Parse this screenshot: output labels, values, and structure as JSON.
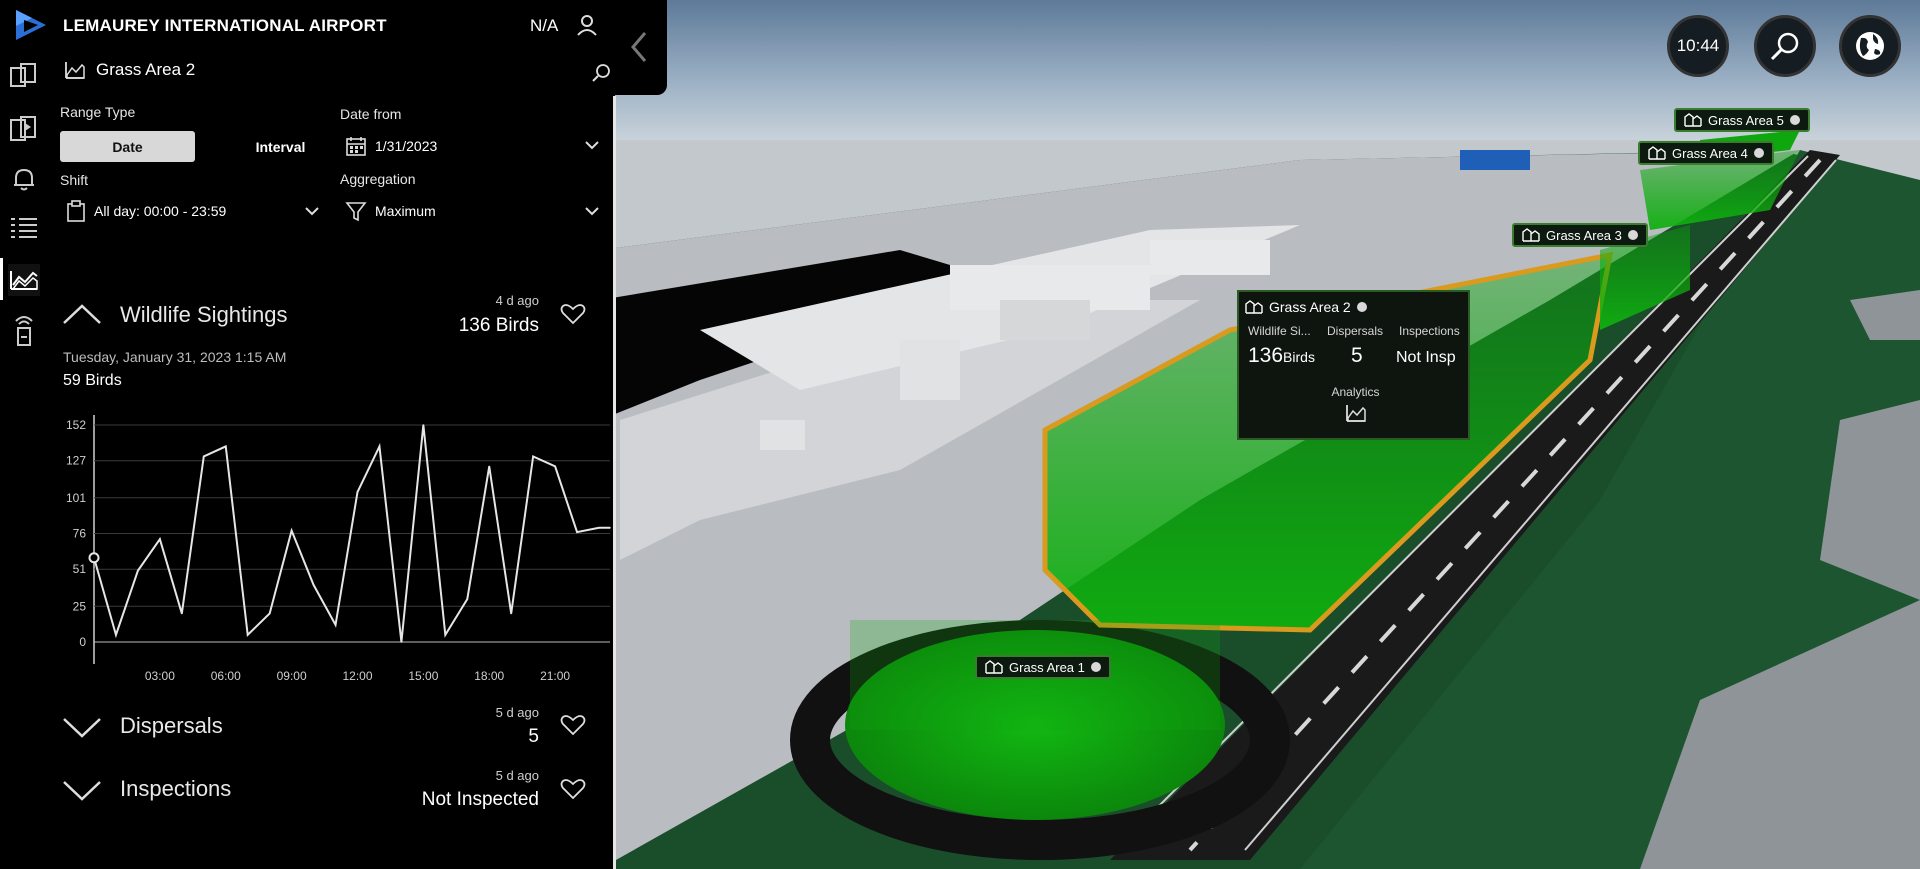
{
  "app": {
    "title": "LEMAUREY INTERNATIONAL AIRPORT",
    "status": "N/A"
  },
  "panel": {
    "area_name": "Grass Area 2",
    "range_type_label": "Range Type",
    "range_options": [
      "Date",
      "Interval"
    ],
    "range_selected": "Date",
    "date_from_label": "Date from",
    "date_from_value": "1/31/2023",
    "shift_label": "Shift",
    "shift_value": "All day: 00:00 - 23:59",
    "aggregation_label": "Aggregation",
    "aggregation_value": "Maximum"
  },
  "sections": {
    "wildlife": {
      "title": "Wildlife Sightings",
      "ago": "4 d ago",
      "value": "136 Birds",
      "selected_time": "Tuesday, January 31, 2023 1:15 AM",
      "selected_value": "59 Birds"
    },
    "dispersals": {
      "title": "Dispersals",
      "ago": "5 d ago",
      "value": "5"
    },
    "inspections": {
      "title": "Inspections",
      "ago": "5 d ago",
      "value": "Not Inspected"
    }
  },
  "chart_data": {
    "type": "line",
    "title": "",
    "xlabel": "",
    "ylabel": "",
    "x_ticks": [
      "03:00",
      "06:00",
      "09:00",
      "12:00",
      "15:00",
      "18:00",
      "21:00"
    ],
    "y_ticks": [
      "0",
      "25",
      "51",
      "76",
      "101",
      "127",
      "152"
    ],
    "ylim": [
      0,
      152
    ],
    "xlim": [
      0,
      23.5
    ],
    "x": [
      0,
      1,
      2,
      3,
      4,
      5,
      6,
      7,
      8,
      9,
      10,
      11,
      12,
      13,
      14,
      15,
      16,
      17,
      18,
      19,
      20,
      21,
      22,
      23,
      23.5
    ],
    "values": [
      59,
      5,
      50,
      72,
      20,
      130,
      137,
      5,
      20,
      78,
      40,
      12,
      105,
      137,
      0,
      152,
      5,
      30,
      123,
      20,
      130,
      123,
      77,
      80,
      80
    ],
    "highlight_index": 0,
    "grid": true,
    "line_color": "#e6e6e6"
  },
  "hud": {
    "time": "10:44"
  },
  "map": {
    "tags": [
      "Grass Area 1",
      "Grass Area 2",
      "Grass Area 3",
      "Grass Area 4",
      "Grass Area 5"
    ],
    "popup": {
      "title": "Grass Area 2",
      "col1_label": "Wildlife Si...",
      "col1_value": "136",
      "col1_unit": "Birds",
      "col2_label": "Dispersals",
      "col2_value": "5",
      "col3_label": "Inspections",
      "col3_value": "Not Insp",
      "analytics_label": "Analytics"
    }
  },
  "colors": {
    "accent_green": "#1fb31f",
    "selection_outline": "#d99a1e",
    "panel_bg": "#000000"
  }
}
